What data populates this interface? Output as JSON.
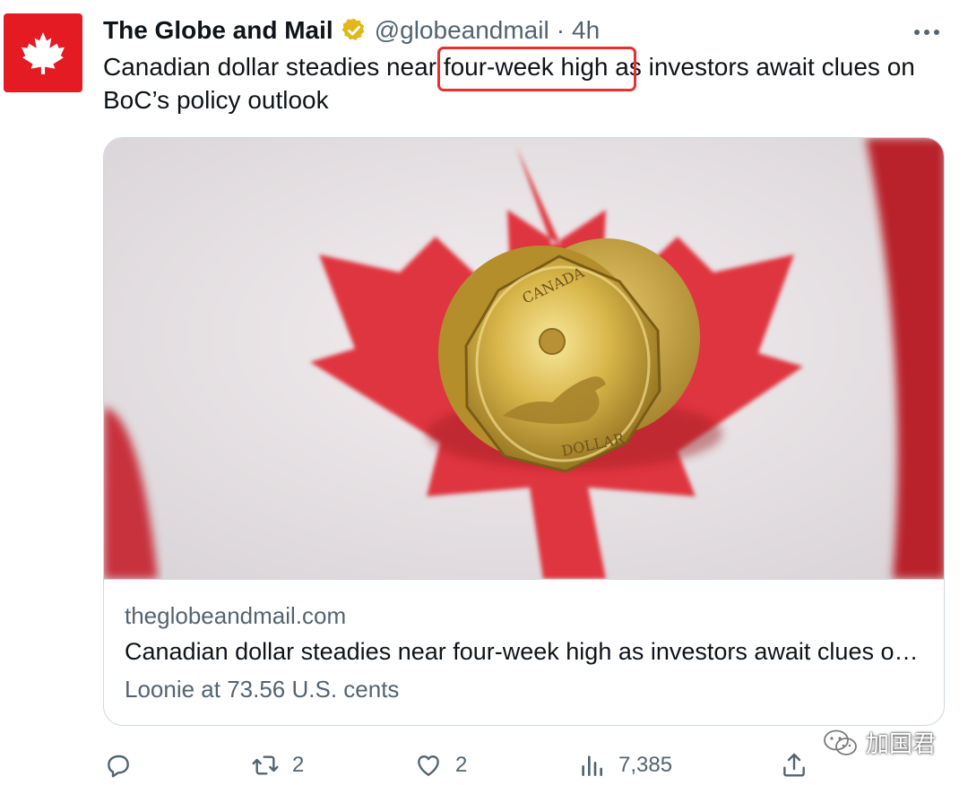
{
  "tweet": {
    "author": {
      "display_name": "The Globe and Mail",
      "handle": "@globeandmail",
      "separator": "·",
      "time": "4h",
      "verified_icon": "gold-verified-badge-icon",
      "avatar_icon": "maple-leaf-icon"
    },
    "more_icon": "more-dots-icon",
    "text_before": "Canadian dollar steadies near ",
    "text_highlight": "four-week high",
    "text_after": " as investors await clues on BoC’s policy outlook"
  },
  "card": {
    "image_subject": "Canadian one-dollar loonie coin in front of Canadian flag",
    "coin_text_top": "CANADA",
    "coin_text_bottom": "DOLLAR",
    "domain": "theglobeandmail.com",
    "title": "Canadian dollar steadies near four-week high as investors await clues on BoC’s policy outlook",
    "description": "Loonie at 73.56 U.S. cents"
  },
  "actions": {
    "reply": {
      "icon": "reply-icon",
      "count": ""
    },
    "retweet": {
      "icon": "retweet-icon",
      "count": "2"
    },
    "like": {
      "icon": "heart-icon",
      "count": "2"
    },
    "views": {
      "icon": "views-chart-icon",
      "count": "7,385"
    },
    "share": {
      "icon": "share-icon"
    }
  },
  "watermark": {
    "text": "加国君",
    "icon": "wechat-icon"
  },
  "colors": {
    "brand_red": "#e51b24",
    "highlight_outline": "#e8302f",
    "secondary_text": "#536471",
    "verified_gold": "#e2b719"
  }
}
